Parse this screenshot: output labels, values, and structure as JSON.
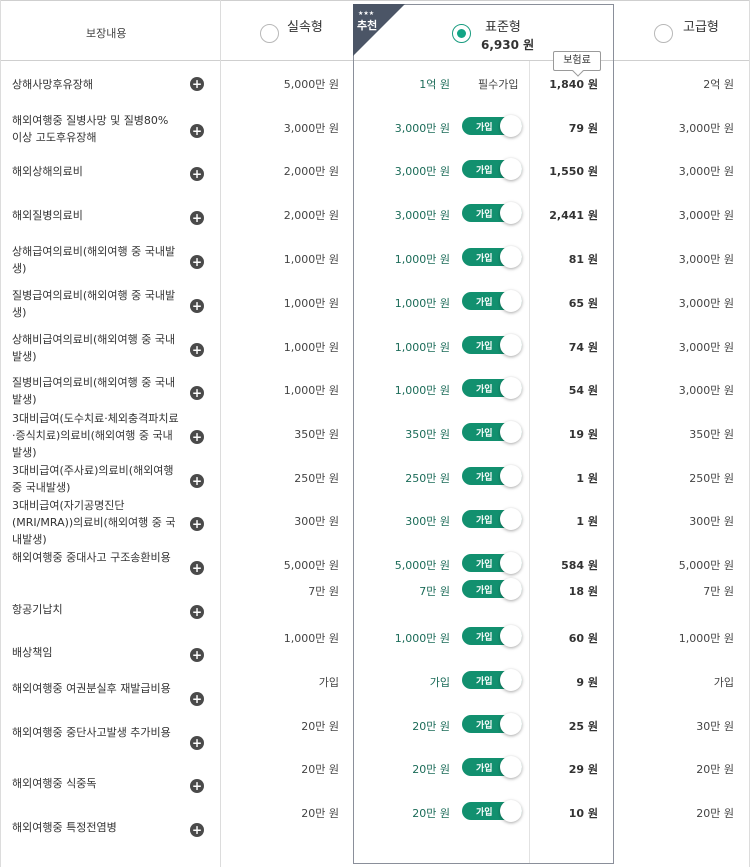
{
  "header": {
    "coverage_label": "보장내용",
    "ribbon_stars": "★★★",
    "ribbon_text": "추천",
    "plans": [
      {
        "name": "실속형",
        "price": "",
        "selected": false
      },
      {
        "name": "표준형",
        "price": "6,930 원",
        "selected": true
      },
      {
        "name": "고급형",
        "price": "",
        "selected": false
      }
    ],
    "premium_tooltip": "보험료",
    "toggle_label": "가입",
    "required_label": "필수가입"
  },
  "rows": [
    {
      "name": "상해사망후유장해",
      "basic": "5,000만 원",
      "std": "1억 원",
      "required": true,
      "premium": "1,840 원",
      "prem": "2억 원"
    },
    {
      "name": "해외여행중 질병사망 및 질병80% 이상 고도후유장해",
      "basic": "3,000만 원",
      "std": "3,000만 원",
      "required": false,
      "premium": "79 원",
      "prem": "3,000만 원"
    },
    {
      "name": "해외상해의료비",
      "basic": "2,000만 원",
      "std": "3,000만 원",
      "required": false,
      "premium": "1,550 원",
      "prem": "3,000만 원"
    },
    {
      "name": "해외질병의료비",
      "basic": "2,000만 원",
      "std": "3,000만 원",
      "required": false,
      "premium": "2,441 원",
      "prem": "3,000만 원"
    },
    {
      "name": "상해급여의료비(해외여행 중 국내발생)",
      "basic": "1,000만 원",
      "std": "1,000만 원",
      "required": false,
      "premium": "81 원",
      "prem": "3,000만 원"
    },
    {
      "name": "질병급여의료비(해외여행 중 국내발생)",
      "basic": "1,000만 원",
      "std": "1,000만 원",
      "required": false,
      "premium": "65 원",
      "prem": "3,000만 원"
    },
    {
      "name": "상해비급여의료비(해외여행 중 국내발생)",
      "basic": "1,000만 원",
      "std": "1,000만 원",
      "required": false,
      "premium": "74 원",
      "prem": "3,000만 원"
    },
    {
      "name": "질병비급여의료비(해외여행 중 국내발생)",
      "basic": "1,000만 원",
      "std": "1,000만 원",
      "required": false,
      "premium": "54 원",
      "prem": "3,000만 원"
    },
    {
      "name": "3대비급여(도수치료·체외충격파치료·증식치료)의료비(해외여행 중 국내발생)",
      "basic": "350만 원",
      "std": "350만 원",
      "required": false,
      "premium": "19 원",
      "prem": "350만 원"
    },
    {
      "name": "3대비급여(주사료)의료비(해외여행 중 국내발생)",
      "basic": "250만 원",
      "std": "250만 원",
      "required": false,
      "premium": "1 원",
      "prem": "250만 원"
    },
    {
      "name": "3대비급여(자기공명진단(MRI/MRA))의료비(해외여행 중 국내발생)",
      "basic": "300만 원",
      "std": "300만 원",
      "required": false,
      "premium": "1 원",
      "prem": "300만 원"
    },
    {
      "name": "해외여행중 중대사고 구조송환비용",
      "basic": "5,000만 원",
      "std": "5,000만 원",
      "required": false,
      "premium": "584 원",
      "prem": "5,000만 원"
    },
    {
      "name": "항공기납치",
      "basic": "7만 원",
      "std": "7만 원",
      "required": false,
      "premium": "18 원",
      "prem": "7만 원"
    },
    {
      "name": "배상책임",
      "basic": "1,000만 원",
      "std": "1,000만 원",
      "required": false,
      "premium": "60 원",
      "prem": "1,000만 원"
    },
    {
      "name": "해외여행중 여권분실후 재발급비용",
      "basic": "가입",
      "std": "가입",
      "required": false,
      "premium": "9 원",
      "prem": "가입"
    },
    {
      "name": "해외여행중 중단사고발생 추가비용",
      "basic": "20만 원",
      "std": "20만 원",
      "required": false,
      "premium": "25 원",
      "prem": "30만 원"
    },
    {
      "name": "해외여행중 식중독",
      "basic": "20만 원",
      "std": "20만 원",
      "required": false,
      "premium": "29 원",
      "prem": "20만 원"
    },
    {
      "name": "해외여행중 특정전염병",
      "basic": "20만 원",
      "std": "20만 원",
      "required": false,
      "premium": "10 원",
      "prem": "20만 원"
    }
  ],
  "colors": {
    "accent": "#12a585",
    "toggle": "#12906f",
    "std_value": "#1b6b58",
    "border": "#dcdcdc",
    "ribbon": "#4b5566"
  }
}
